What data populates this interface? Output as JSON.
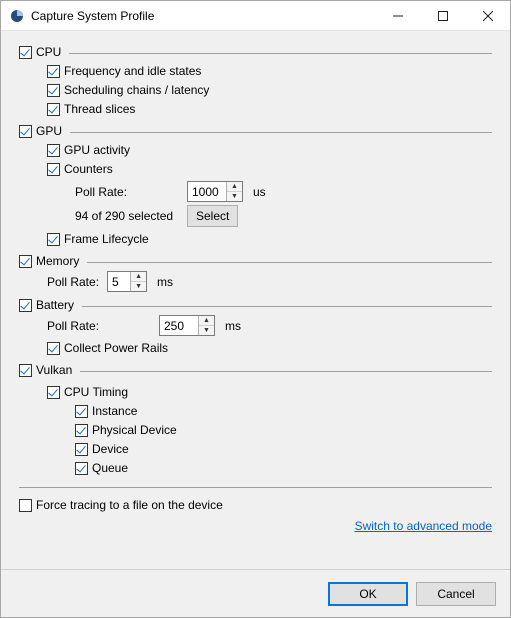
{
  "window": {
    "title": "Capture System Profile"
  },
  "sections": {
    "cpu": {
      "label": "CPU",
      "freq": "Frequency and idle states",
      "sched": "Scheduling chains / latency",
      "slices": "Thread slices"
    },
    "gpu": {
      "label": "GPU",
      "activity": "GPU activity",
      "counters": "Counters",
      "pollRateLabel": "Poll Rate:",
      "pollRateValue": "1000",
      "pollRateUnit": "us",
      "selectedText": "94 of 290 selected",
      "selectBtn": "Select",
      "frameLifecycle": "Frame Lifecycle"
    },
    "memory": {
      "label": "Memory",
      "pollRateLabel": "Poll Rate:",
      "pollRateValue": "5",
      "pollRateUnit": "ms"
    },
    "battery": {
      "label": "Battery",
      "pollRateLabel": "Poll Rate:",
      "pollRateValue": "250",
      "pollRateUnit": "ms",
      "collectPowerRails": "Collect Power Rails"
    },
    "vulkan": {
      "label": "Vulkan",
      "cpuTiming": "CPU Timing",
      "instance": "Instance",
      "physicalDevice": "Physical Device",
      "device": "Device",
      "queue": "Queue"
    }
  },
  "forceTracing": "Force tracing to a file on the device",
  "advancedLink": "Switch to advanced mode",
  "buttons": {
    "ok": "OK",
    "cancel": "Cancel"
  }
}
